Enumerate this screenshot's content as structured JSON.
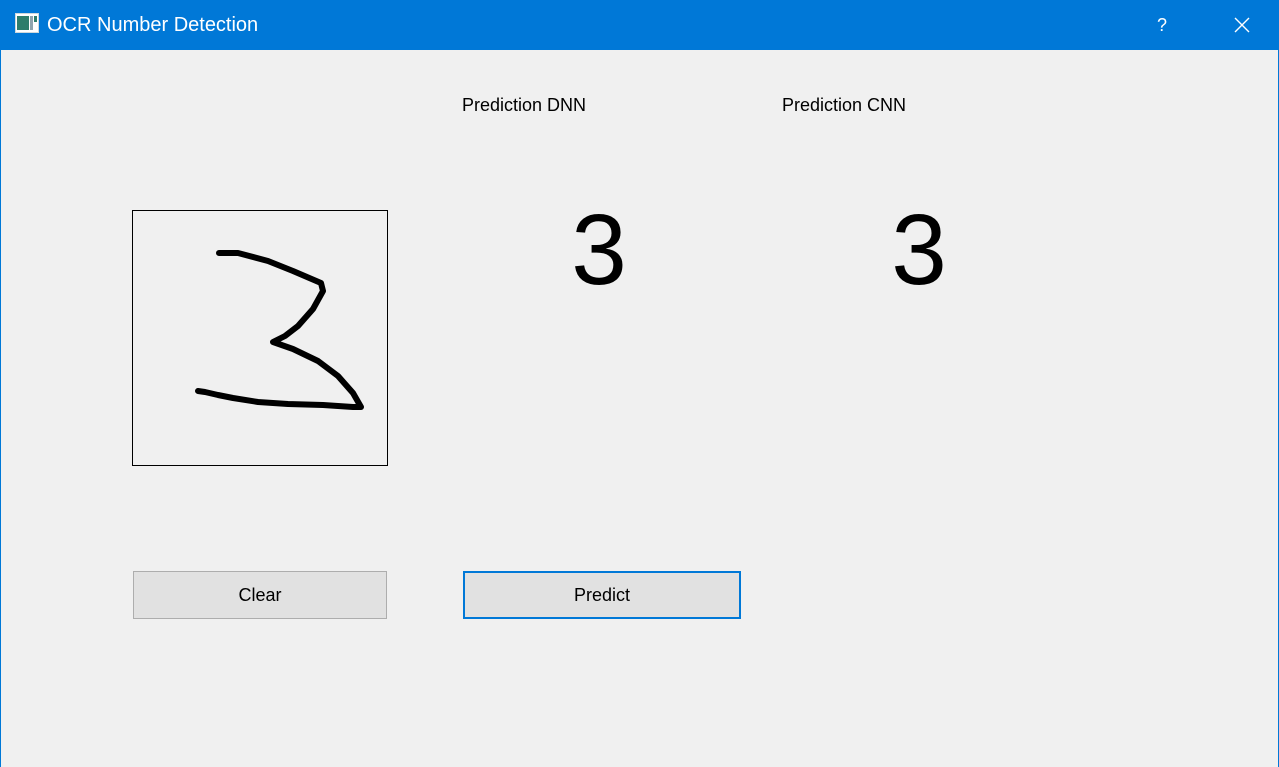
{
  "window": {
    "title": "OCR Number Detection",
    "help_label": "?",
    "accent_color": "#0078d7"
  },
  "predictions": {
    "dnn_label": "Prediction DNN",
    "dnn_value": "3",
    "cnn_label": "Prediction CNN",
    "cnn_value": "3"
  },
  "buttons": {
    "clear_label": "Clear",
    "predict_label": "Predict"
  },
  "icons": {
    "app": "app-window-icon",
    "close": "close-icon"
  }
}
